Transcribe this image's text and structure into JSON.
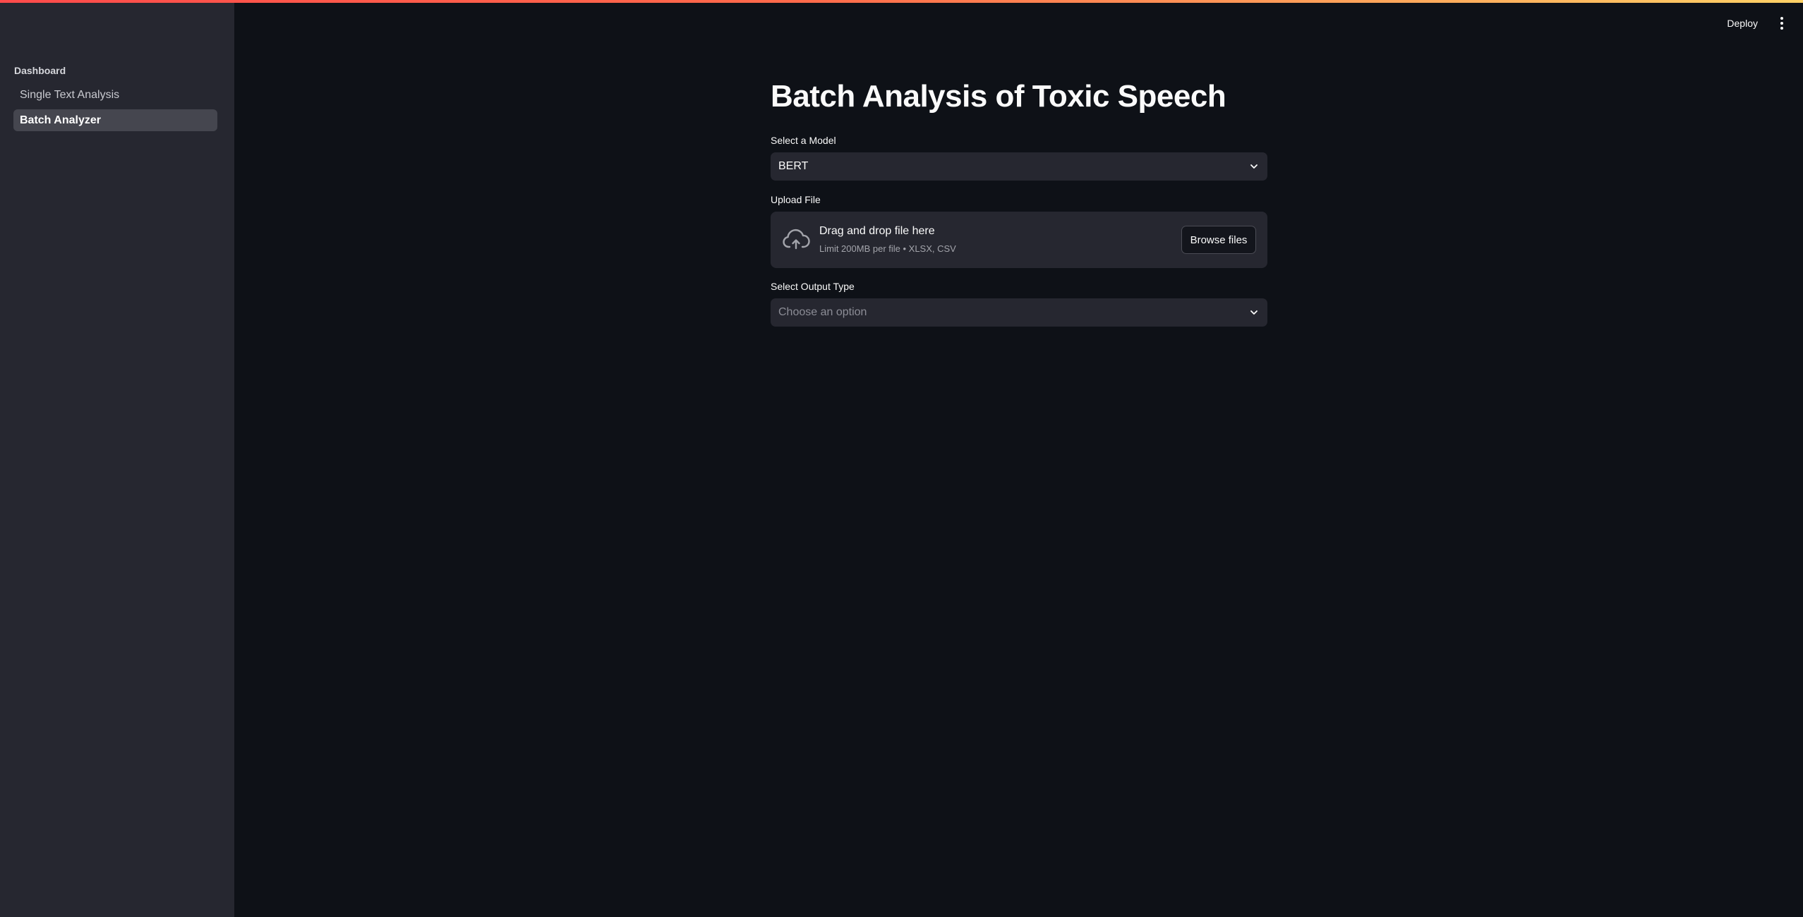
{
  "sidebar": {
    "heading": "Dashboard",
    "items": [
      {
        "label": "Single Text Analysis",
        "active": false
      },
      {
        "label": "Batch Analyzer",
        "active": true
      }
    ]
  },
  "header": {
    "deploy_label": "Deploy",
    "menu_icon": "more-vertical-icon"
  },
  "main": {
    "title": "Batch Analysis of Toxic Speech",
    "model_select": {
      "label": "Select a Model",
      "value": "BERT"
    },
    "upload": {
      "label": "Upload File",
      "title": "Drag and drop file here",
      "limit": "Limit 200MB per file • XLSX, CSV",
      "button_label": "Browse files",
      "icon": "cloud-upload-icon"
    },
    "output_select": {
      "label": "Select Output Type",
      "placeholder": "Choose an option"
    }
  },
  "colors": {
    "background": "#0e1117",
    "sidebar": "#262730",
    "active_item": "#45464f",
    "accent_gradient": [
      "#ff4b4b",
      "#ffd166"
    ]
  }
}
